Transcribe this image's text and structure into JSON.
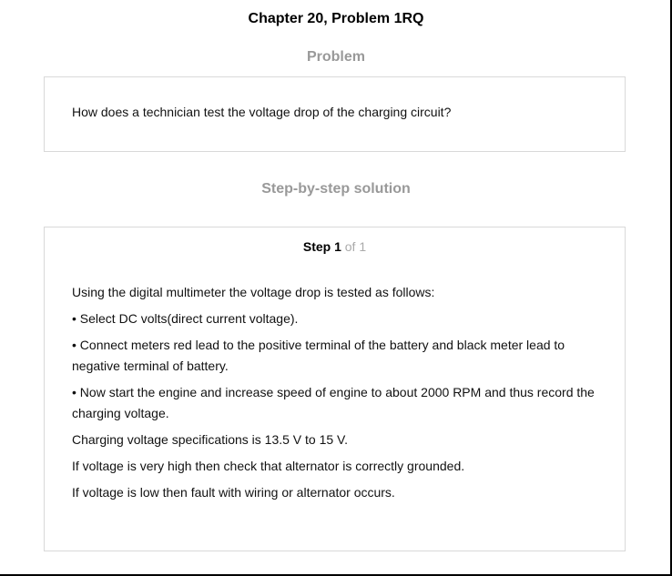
{
  "header": {
    "chapter_title": "Chapter 20, Problem 1RQ"
  },
  "problem": {
    "heading": "Problem",
    "text": "How does a technician test the voltage drop of the charging circuit?"
  },
  "solution": {
    "heading": "Step-by-step solution",
    "step_label": "Step 1",
    "step_of": "of 1",
    "paragraphs": [
      "Using the digital multimeter the voltage drop is tested as follows:",
      "• Select DC volts(direct current voltage).",
      "• Connect meters red lead to the positive terminal of the battery and black meter lead to negative terminal of battery.",
      "• Now start the engine and increase speed of engine to about 2000 RPM and thus record the charging voltage.",
      "Charging voltage specifications is 13.5 V to 15 V.",
      "If voltage is very high then check that alternator is correctly grounded.",
      "If voltage is low then fault with wiring or alternator occurs."
    ]
  }
}
